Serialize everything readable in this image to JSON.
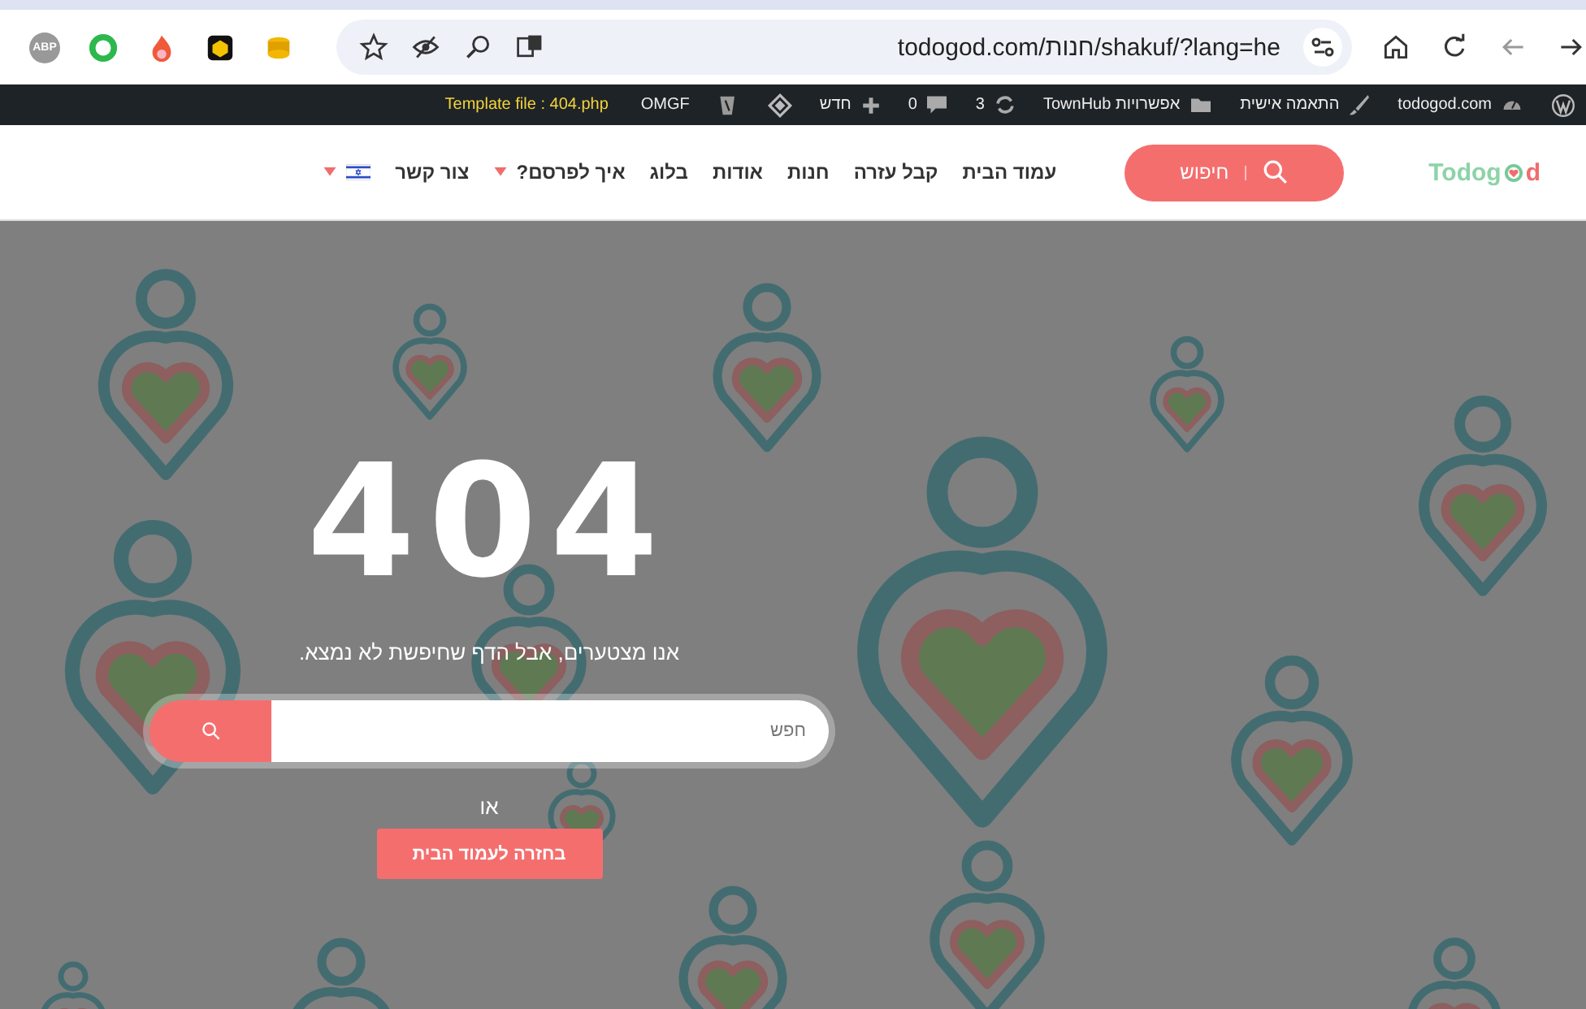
{
  "browser": {
    "extensions": [
      {
        "kind": "abp",
        "label": "ABP"
      },
      {
        "kind": "ring"
      },
      {
        "kind": "flame"
      },
      {
        "kind": "cube"
      },
      {
        "kind": "coins"
      }
    ],
    "url": "todogod.com/חנות/shakuf/?lang=he"
  },
  "admin_bar": {
    "items": [
      {
        "kind": "wp"
      },
      {
        "kind": "dashboard",
        "label": "todogod.com"
      },
      {
        "kind": "brush",
        "label": "התאמה אישית"
      },
      {
        "kind": "folder",
        "label": "אפשרויות TownHub"
      },
      {
        "kind": "refresh",
        "label": "3"
      },
      {
        "kind": "comment",
        "label": "0"
      },
      {
        "kind": "plus",
        "label": "חדש"
      },
      {
        "kind": "diamond"
      },
      {
        "kind": "plugin"
      },
      {
        "kind": "text",
        "label": "OMGF"
      },
      {
        "kind": "template",
        "label": "Template file : 404.php"
      }
    ]
  },
  "header": {
    "logo": {
      "part_1": "Todog",
      "part_2": "d"
    },
    "search_button": "חיפוש",
    "nav": [
      {
        "label": "עמוד הבית",
        "dropdown": false
      },
      {
        "label": "קבל עזרה",
        "dropdown": false
      },
      {
        "label": "חנות",
        "dropdown": false
      },
      {
        "label": "אודות",
        "dropdown": false
      },
      {
        "label": "בלוג",
        "dropdown": false
      },
      {
        "label": "איך לפרסם?",
        "dropdown": true
      },
      {
        "label": "צור קשר",
        "dropdown": false
      }
    ],
    "language": {
      "dropdown": true
    }
  },
  "error": {
    "code": "404",
    "message": "אנו מצטערים, אבל הדף שחיפשת לא נמצא.",
    "search": {
      "placeholder": "חפש"
    },
    "or": "או",
    "home_button": "בחזרה לעמוד הבית"
  }
}
